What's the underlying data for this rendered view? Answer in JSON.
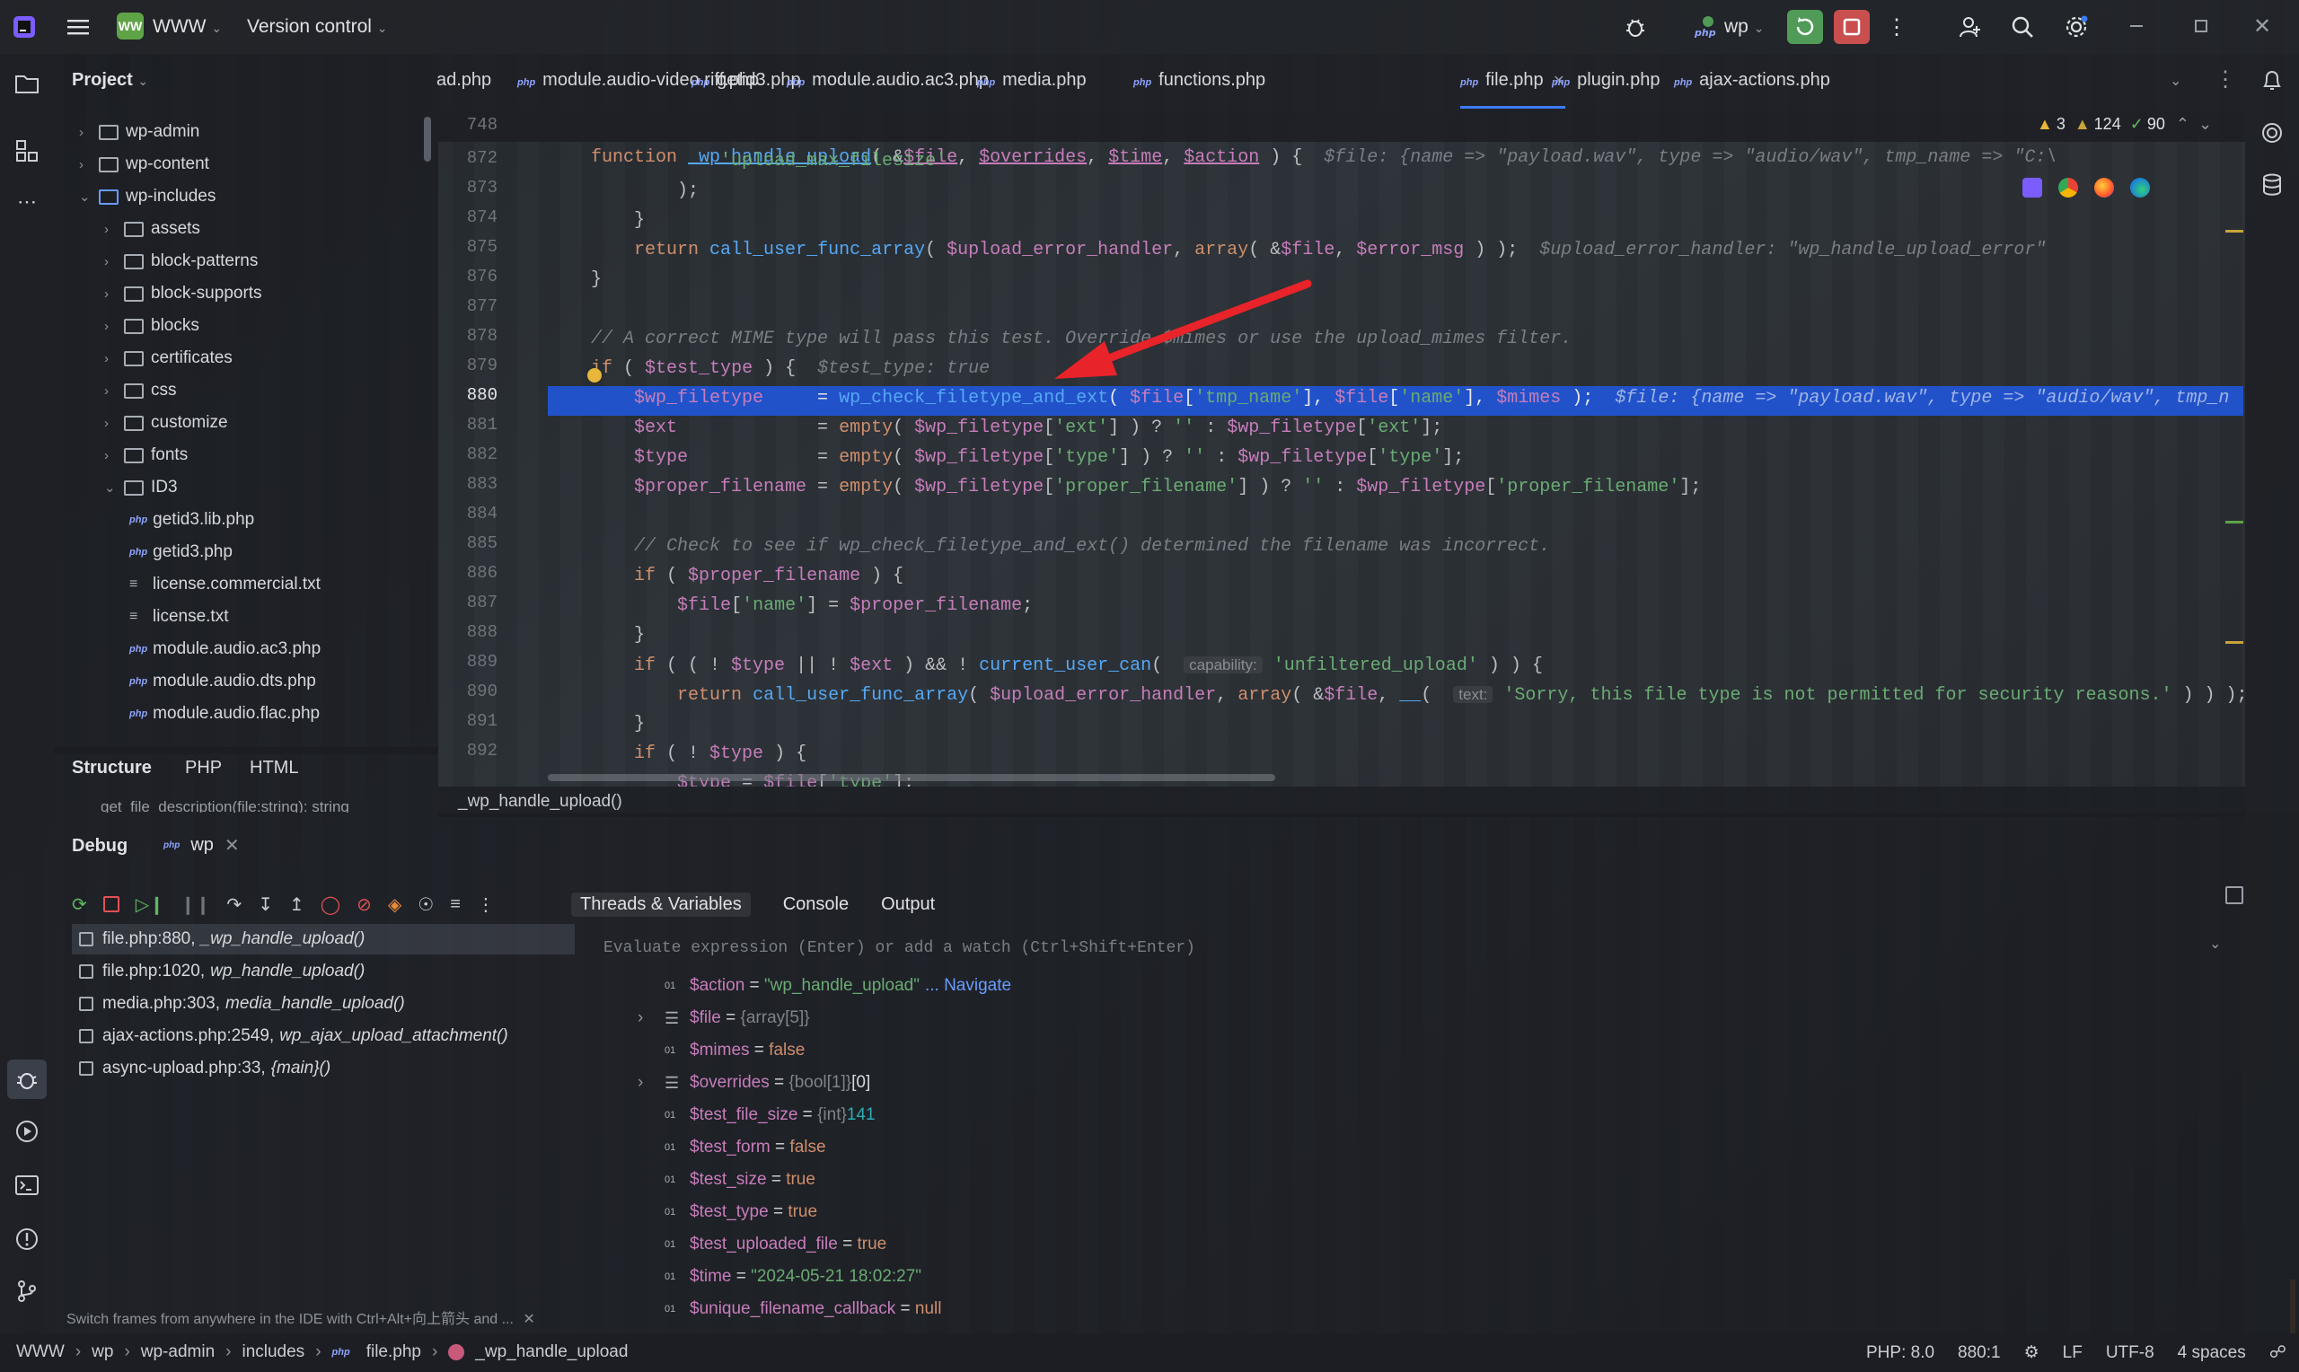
{
  "titlebar": {
    "project_badge": "WW",
    "project_name": "WWW",
    "vcs": "Version control",
    "run_config": "wp"
  },
  "project": {
    "title": "Project",
    "items": [
      {
        "label": "wp-admin",
        "kind": "folder",
        "depth": 0,
        "open": false
      },
      {
        "label": "wp-content",
        "kind": "folder",
        "depth": 0,
        "open": false
      },
      {
        "label": "wp-includes",
        "kind": "folder",
        "depth": 0,
        "open": true
      },
      {
        "label": "assets",
        "kind": "folder",
        "depth": 1,
        "open": false
      },
      {
        "label": "block-patterns",
        "kind": "folder",
        "depth": 1,
        "open": false
      },
      {
        "label": "block-supports",
        "kind": "folder",
        "depth": 1,
        "open": false
      },
      {
        "label": "blocks",
        "kind": "folder",
        "depth": 1,
        "open": false
      },
      {
        "label": "certificates",
        "kind": "folder",
        "depth": 1,
        "open": false
      },
      {
        "label": "css",
        "kind": "folder",
        "depth": 1,
        "open": false
      },
      {
        "label": "customize",
        "kind": "folder",
        "depth": 1,
        "open": false
      },
      {
        "label": "fonts",
        "kind": "folder",
        "depth": 1,
        "open": false
      },
      {
        "label": "ID3",
        "kind": "folder",
        "depth": 1,
        "open": true
      },
      {
        "label": "getid3.lib.php",
        "kind": "php",
        "depth": 2
      },
      {
        "label": "getid3.php",
        "kind": "php",
        "depth": 2
      },
      {
        "label": "license.commercial.txt",
        "kind": "txt",
        "depth": 2
      },
      {
        "label": "license.txt",
        "kind": "txt",
        "depth": 2
      },
      {
        "label": "module.audio.ac3.php",
        "kind": "php",
        "depth": 2
      },
      {
        "label": "module.audio.dts.php",
        "kind": "php",
        "depth": 2
      },
      {
        "label": "module.audio.flac.php",
        "kind": "php",
        "depth": 2
      }
    ]
  },
  "structure": {
    "tabs": [
      "Structure",
      "PHP",
      "HTML"
    ],
    "clipped_item": "get_file_description(file:string): string"
  },
  "tabs": [
    "ad.php",
    "module.audio-video.riff.php",
    "getid3.php",
    "module.audio.ac3.php",
    "media.php",
    "functions.php",
    "file.php",
    "plugin.php",
    "ajax-actions.php"
  ],
  "active_tab": "file.php",
  "inspections": {
    "warnings": "3",
    "weak_warnings": "124",
    "ok": "90"
  },
  "editor": {
    "sticky_line": "748",
    "sticky_code": "function _wp_handle_upload( &$file, $overrides, $time, $action ) {",
    "sticky_hint": "$file: {name => \"payload.wav\", type => \"audio/wav\", tmp_name => \"C:\\",
    "lines": [
      "872",
      "873",
      "874",
      "875",
      "876",
      "877",
      "878",
      "879",
      "880",
      "881",
      "882",
      "883",
      "884",
      "885",
      "886",
      "887",
      "888",
      "889",
      "890",
      "891",
      "892"
    ],
    "c872": "'upload_max_filesize'",
    "c875_hint": "$upload_error_handler: \"wp_handle_upload_error\"",
    "c878": "// A correct MIME type will pass this test. Override $mimes or use the upload_mimes filter.",
    "c879_hint": "$test_type: true",
    "c880_hint": "$file: {name => \"payload.wav\", type => \"audio/wav\", tmp_n",
    "c885": "// Check to see if wp_check_filetype_and_ext() determined the filename was incorrect.",
    "c889_param": "capability:",
    "c890_param": "text:",
    "c890_str": "'Sorry, this file type is not permitted for security reasons.'",
    "breadcrumb": "_wp_handle_upload()"
  },
  "debug": {
    "title": "Debug",
    "session": "wp",
    "tabs": [
      "Threads & Variables",
      "Console",
      "Output"
    ],
    "frames": [
      {
        "loc": "file.php:880,",
        "fn": "_wp_handle_upload()"
      },
      {
        "loc": "file.php:1020,",
        "fn": "wp_handle_upload()"
      },
      {
        "loc": "media.php:303,",
        "fn": "media_handle_upload()"
      },
      {
        "loc": "ajax-actions.php:2549,",
        "fn": "wp_ajax_upload_attachment()"
      },
      {
        "loc": "async-upload.php:33,",
        "fn": "{main}()"
      }
    ],
    "hint": "Switch frames from anywhere in the IDE with Ctrl+Alt+向上箭头 and ...",
    "eval_placeholder": "Evaluate expression (Enter) or add a watch (Ctrl+Shift+Enter)",
    "variables": [
      {
        "name": "$action",
        "eq": " = ",
        "type": "",
        "value": "\"wp_handle_upload\"",
        "kind": "str",
        "extra": "... Navigate",
        "expand": false,
        "array": false
      },
      {
        "name": "$file",
        "eq": " = ",
        "type": "{array[5]}",
        "value": "",
        "kind": "",
        "extra": "",
        "expand": true,
        "array": true
      },
      {
        "name": "$mimes",
        "eq": " = ",
        "type": "",
        "value": "false",
        "kind": "kw",
        "extra": "",
        "expand": false,
        "array": false
      },
      {
        "name": "$overrides",
        "eq": " = ",
        "type": "{bool[1]}",
        "value": "[0]",
        "kind": "plain",
        "extra": "",
        "expand": true,
        "array": true
      },
      {
        "name": "$test_file_size",
        "eq": " = ",
        "type": "{int}",
        "value": "141",
        "kind": "num",
        "extra": "",
        "expand": false,
        "array": false
      },
      {
        "name": "$test_form",
        "eq": " = ",
        "type": "",
        "value": "false",
        "kind": "kw",
        "extra": "",
        "expand": false,
        "array": false
      },
      {
        "name": "$test_size",
        "eq": " = ",
        "type": "",
        "value": "true",
        "kind": "kw",
        "extra": "",
        "expand": false,
        "array": false
      },
      {
        "name": "$test_type",
        "eq": " = ",
        "type": "",
        "value": "true",
        "kind": "kw",
        "extra": "",
        "expand": false,
        "array": false
      },
      {
        "name": "$test_uploaded_file",
        "eq": " = ",
        "type": "",
        "value": "true",
        "kind": "kw",
        "extra": "",
        "expand": false,
        "array": false
      },
      {
        "name": "$time",
        "eq": " = ",
        "type": "",
        "value": "\"2024-05-21 18:02:27\"",
        "kind": "str",
        "extra": "",
        "expand": false,
        "array": false
      },
      {
        "name": "$unique_filename_callback",
        "eq": " = ",
        "type": "",
        "value": "null",
        "kind": "kw",
        "extra": "",
        "expand": false,
        "array": false
      }
    ]
  },
  "status": {
    "crumbs": [
      "WWW",
      "wp",
      "wp-admin",
      "includes",
      "file.php",
      "_wp_handle_upload"
    ],
    "php": "PHP: 8.0",
    "pos": "880:1",
    "lf": "LF",
    "enc": "UTF-8",
    "indent": "4 spaces"
  },
  "colors": {
    "accent": "#2152c9",
    "arrow": "#e8232a",
    "run_green": "#4f9b57",
    "stop_red": "#c94f4f"
  }
}
